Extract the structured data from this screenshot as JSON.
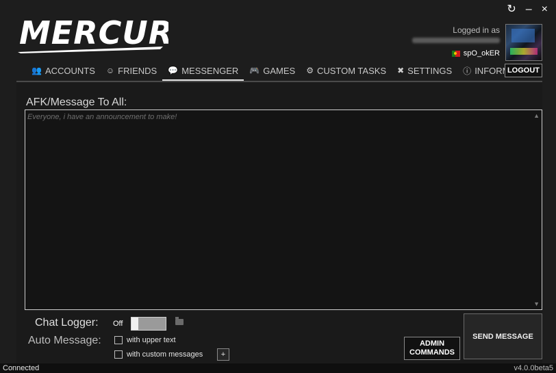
{
  "window": {
    "controls": {
      "refresh_icon": "↻",
      "minimize": "–",
      "close": "×"
    }
  },
  "brand": {
    "logo_text": "MERCURY"
  },
  "user": {
    "logged_in_label": "Logged in as",
    "username": "spO_okER"
  },
  "nav": {
    "items": [
      {
        "label": "ACCOUNTS",
        "icon": "users-icon"
      },
      {
        "label": "FRIENDS",
        "icon": "smile-icon"
      },
      {
        "label": "MESSENGER",
        "icon": "chat-icon"
      },
      {
        "label": "GAMES",
        "icon": "gamepad-icon"
      },
      {
        "label": "CUSTOM TASKS",
        "icon": "gear-icon"
      },
      {
        "label": "SETTINGS",
        "icon": "tools-icon"
      },
      {
        "label": "INFORMATION",
        "icon": "info-icon"
      }
    ],
    "active": "MESSENGER",
    "logout_label": "LOGOUT"
  },
  "messenger": {
    "afk_label": "AFK/Message To All:",
    "message_placeholder": "Everyone, i have an announcement to make!",
    "chat_logger_label": "Chat Logger:",
    "chat_logger_state": "Off",
    "auto_message_label": "Auto Message:",
    "option_upper_text": "with upper text",
    "option_custom_messages": "with custom messages",
    "plus_label": "+",
    "admin_line1": "ADMIN",
    "admin_line2": "COMMANDS",
    "send_label": "SEND MESSAGE"
  },
  "status": {
    "connection": "Connected",
    "version": "v4.0.0beta5"
  }
}
